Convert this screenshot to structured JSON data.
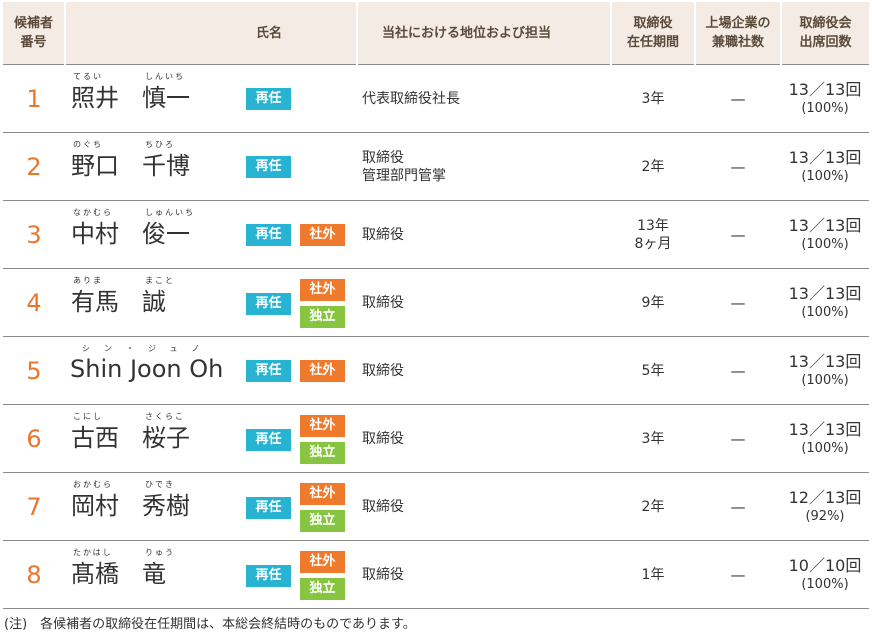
{
  "headers": {
    "no_line1": "候補者",
    "no_line2": "番号",
    "name": "氏名",
    "role": "当社における地位および担当",
    "term_line1": "取締役",
    "term_line2": "在任期間",
    "other_line1": "上場企業の",
    "other_line2": "兼職社数",
    "attend_line1": "取締役会",
    "attend_line2": "出席回数"
  },
  "badges": {
    "reappoint": "再任",
    "outside": "社外",
    "independent": "独立"
  },
  "colors": {
    "number": "#e8772e",
    "reappoint": "#29b3d2",
    "outside": "#ef7a2c",
    "independent": "#87c540",
    "header_bg": "#f4ece4"
  },
  "rows": [
    {
      "no": "1",
      "surname": "照井",
      "surname_ruby": "てるい",
      "given": "慎一",
      "given_ruby": "しんいち",
      "role1": "代表取締役社長",
      "role2": "",
      "term1": "3年",
      "term2": "",
      "other": "—",
      "attend": "13／13回",
      "attend_pct": "(100%)",
      "outside": false,
      "independent": false
    },
    {
      "no": "2",
      "surname": "野口",
      "surname_ruby": "のぐち",
      "given": "千博",
      "given_ruby": "ちひろ",
      "role1": "取締役",
      "role2": "管理部門管掌",
      "term1": "2年",
      "term2": "",
      "other": "—",
      "attend": "13／13回",
      "attend_pct": "(100%)",
      "outside": false,
      "independent": false
    },
    {
      "no": "3",
      "surname": "中村",
      "surname_ruby": "なかむら",
      "given": "俊一",
      "given_ruby": "しゅんいち",
      "role1": "取締役",
      "role2": "",
      "term1": "13年",
      "term2": "8ヶ月",
      "other": "—",
      "attend": "13／13回",
      "attend_pct": "(100%)",
      "outside": true,
      "independent": false
    },
    {
      "no": "4",
      "surname": "有馬",
      "surname_ruby": "ありま",
      "given": "誠",
      "given_ruby": "まこと",
      "role1": "取締役",
      "role2": "",
      "term1": "9年",
      "term2": "",
      "other": "—",
      "attend": "13／13回",
      "attend_pct": "(100%)",
      "outside": true,
      "independent": true
    },
    {
      "no": "5",
      "roman_name": "Shin Joon Oh",
      "roman_ruby": "シン・ジュノ",
      "role1": "取締役",
      "role2": "",
      "term1": "5年",
      "term2": "",
      "other": "—",
      "attend": "13／13回",
      "attend_pct": "(100%)",
      "outside": true,
      "independent": false
    },
    {
      "no": "6",
      "surname": "古西",
      "surname_ruby": "こにし",
      "given": "桜子",
      "given_ruby": "さくらこ",
      "role1": "取締役",
      "role2": "",
      "term1": "3年",
      "term2": "",
      "other": "—",
      "attend": "13／13回",
      "attend_pct": "(100%)",
      "outside": true,
      "independent": true
    },
    {
      "no": "7",
      "surname": "岡村",
      "surname_ruby": "おかむら",
      "given": "秀樹",
      "given_ruby": "ひでき",
      "role1": "取締役",
      "role2": "",
      "term1": "2年",
      "term2": "",
      "other": "—",
      "attend": "12／13回",
      "attend_pct": "(92%)",
      "outside": true,
      "independent": true
    },
    {
      "no": "8",
      "surname": "髙橋",
      "surname_ruby": "たかはし",
      "given": "竜",
      "given_ruby": "りゅう",
      "role1": "取締役",
      "role2": "",
      "term1": "1年",
      "term2": "",
      "other": "—",
      "attend": "10／10回",
      "attend_pct": "(100%)",
      "outside": true,
      "independent": true
    }
  ],
  "footnote": "(注)　各候補者の取締役在任期間は、本総会終結時のものであります。"
}
